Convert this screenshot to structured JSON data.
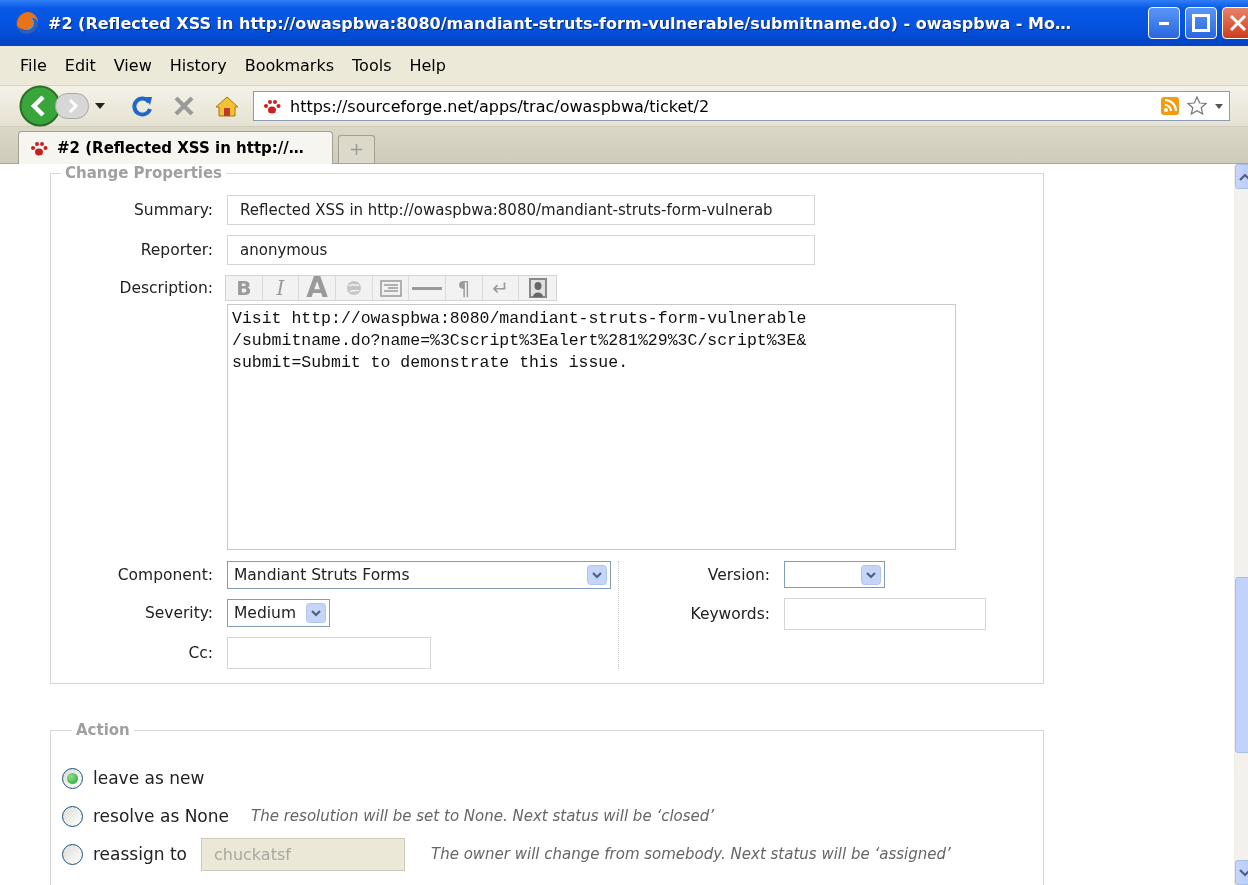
{
  "window": {
    "title": "#2 (Reflected XSS in http://owaspbwa:8080/mandiant-struts-form-vulnerable/submitname.do) - owaspbwa - Mo…"
  },
  "menu": [
    "File",
    "Edit",
    "View",
    "History",
    "Bookmarks",
    "Tools",
    "Help"
  ],
  "address_bar": {
    "url": "https://sourceforge.net/apps/trac/owaspbwa/ticket/2"
  },
  "tabs": [
    {
      "label": "#2 (Reflected XSS in http://…",
      "selected": true
    }
  ],
  "change_properties": {
    "legend": "Change Properties",
    "summary": {
      "label": "Summary:",
      "value": "Reflected XSS in http://owaspbwa:8080/mandiant-struts-form-vulnerab"
    },
    "reporter": {
      "label": "Reporter:",
      "value": "anonymous"
    },
    "description": {
      "label": "Description:",
      "toolbar": [
        {
          "kind": "bold",
          "label": "B"
        },
        {
          "kind": "italic",
          "label": "I"
        },
        {
          "kind": "heading",
          "label": "A"
        },
        {
          "kind": "link"
        },
        {
          "kind": "code"
        },
        {
          "kind": "rule"
        },
        {
          "kind": "paragraph",
          "label": "¶"
        },
        {
          "kind": "break",
          "label": "↵"
        },
        {
          "kind": "image"
        }
      ],
      "value": "Visit http://owaspbwa:8080/mandiant-struts-form-vulnerable\n/submitname.do?name=%3Cscript%3Ealert%281%29%3C/script%3E&\nsubmit=Submit to demonstrate this issue."
    },
    "component": {
      "label": "Component:",
      "value": "Mandiant Struts Forms"
    },
    "severity": {
      "label": "Severity:",
      "value": "Medium"
    },
    "cc": {
      "label": "Cc:"
    },
    "version": {
      "label": "Version:"
    },
    "keywords": {
      "label": "Keywords:"
    }
  },
  "action": {
    "legend": "Action",
    "options": [
      {
        "label": "leave as new",
        "selected": true
      },
      {
        "label": "resolve as None",
        "selected": false,
        "hint": "The resolution will be set to None. Next status will be ‘closed’"
      },
      {
        "label": "reassign to",
        "selected": false,
        "field": {
          "value": "chuckatsf",
          "disabled": true
        },
        "hint": "The owner will change from somebody. Next status will be ‘assigned’"
      }
    ]
  }
}
